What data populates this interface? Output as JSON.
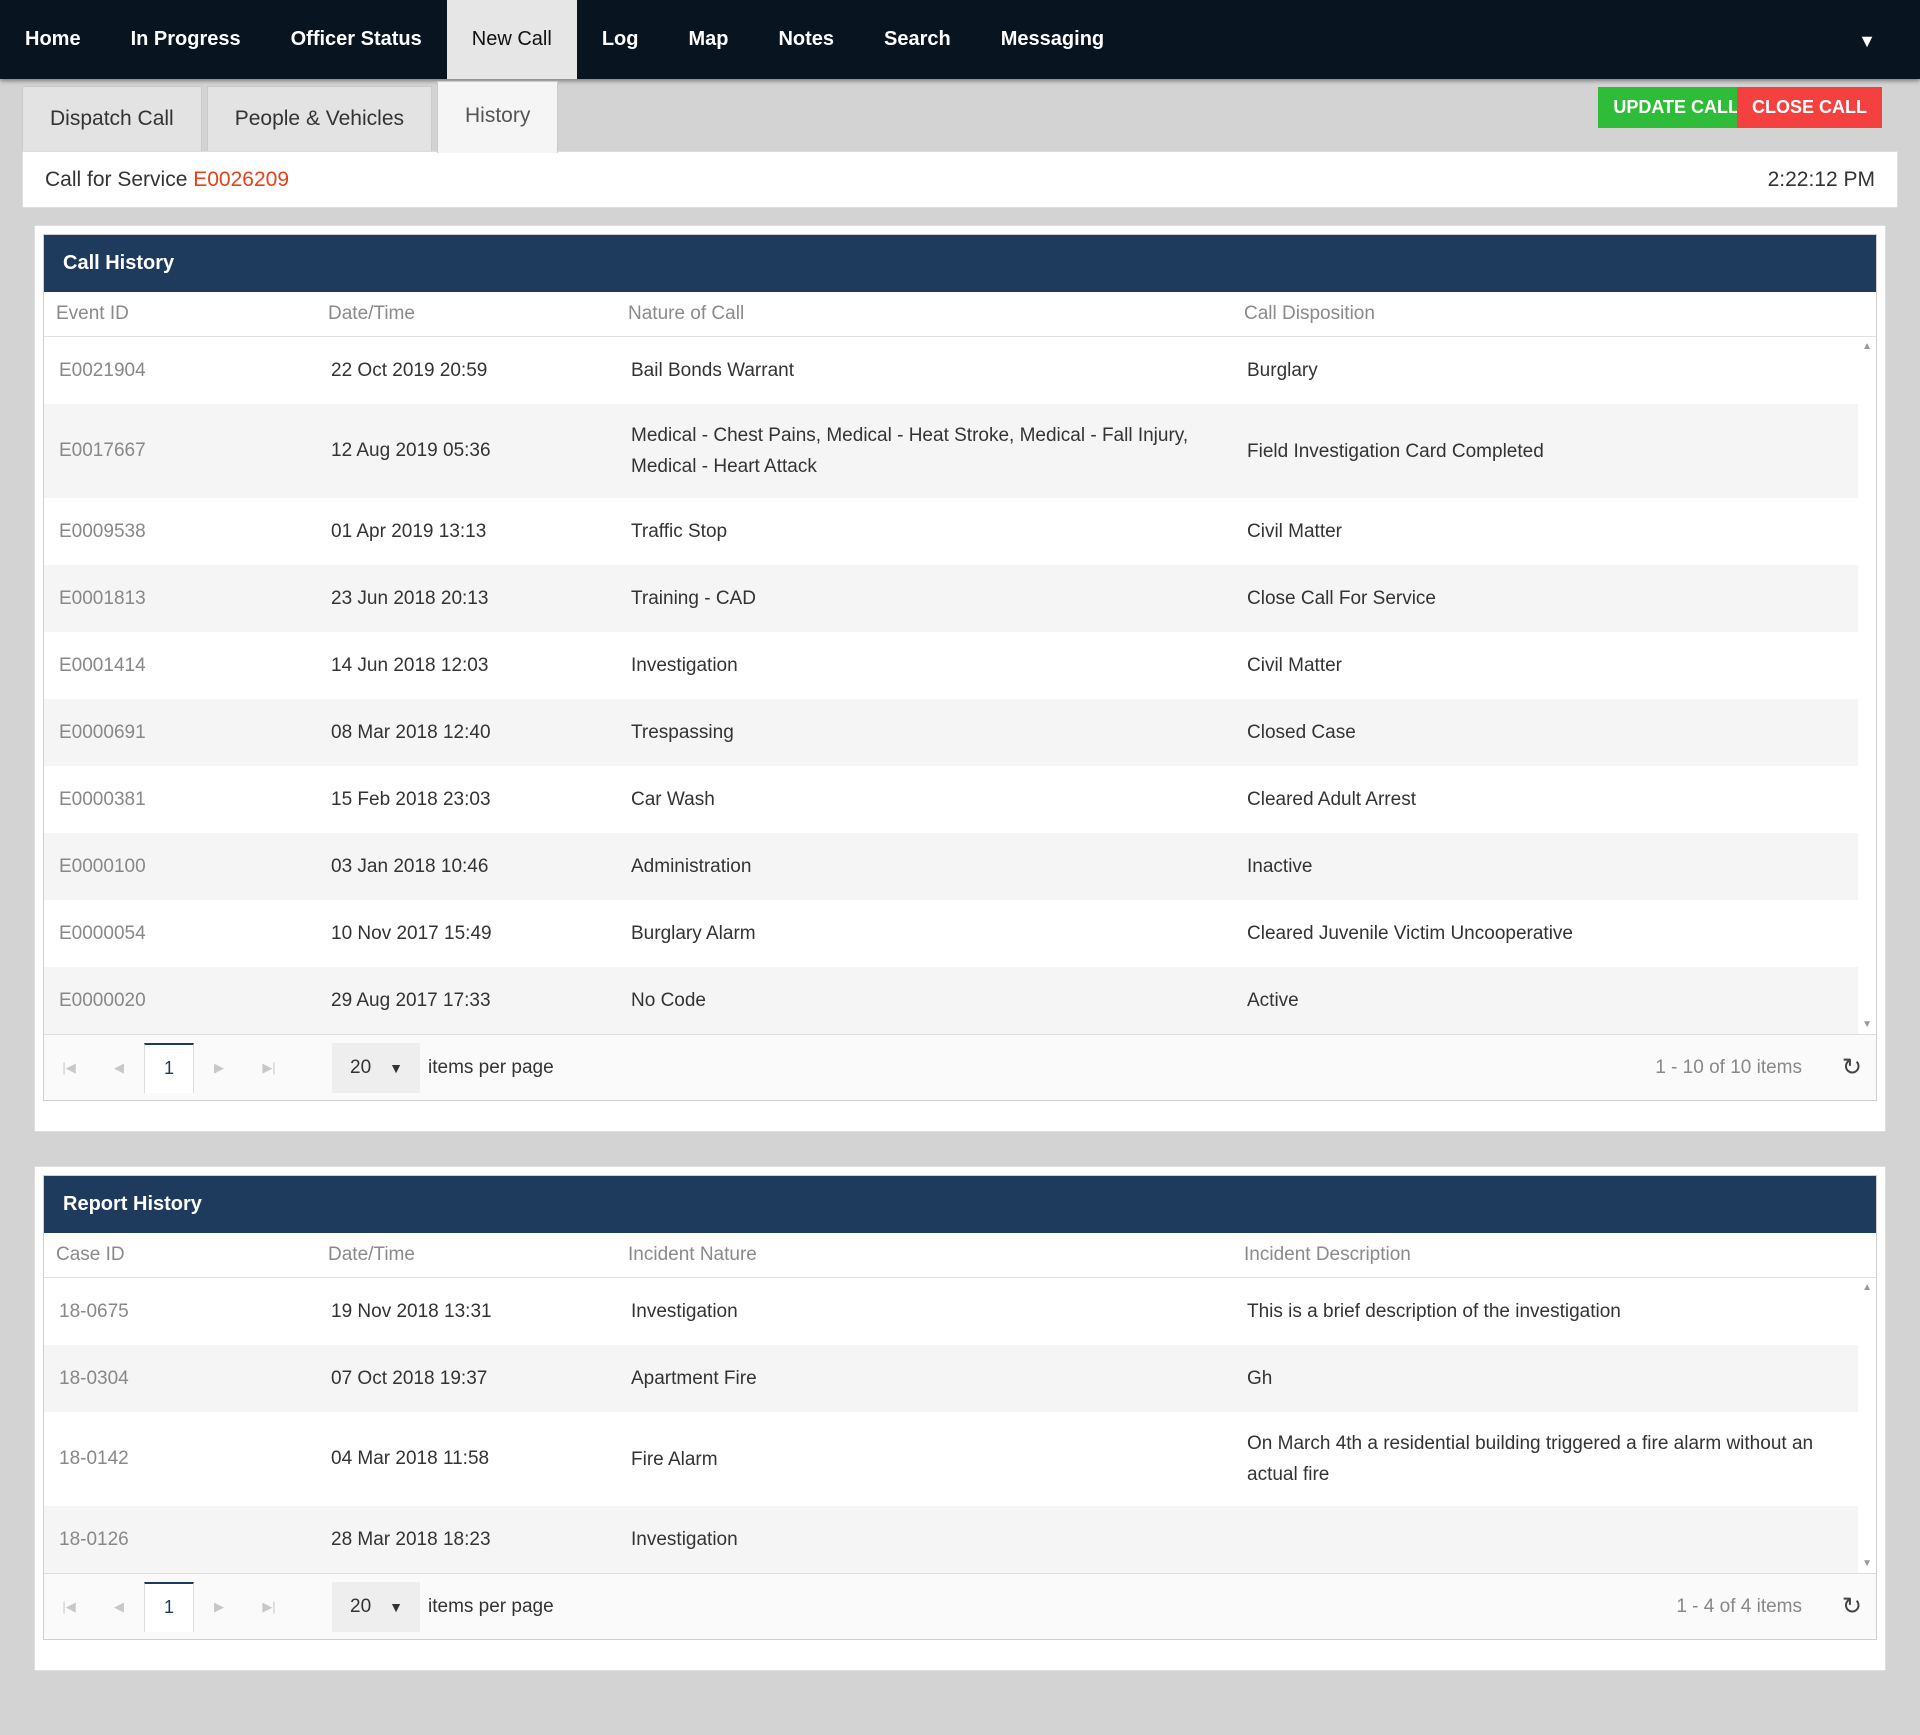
{
  "nav": {
    "items": [
      "Home",
      "In Progress",
      "Officer Status",
      "New Call",
      "Log",
      "Map",
      "Notes",
      "Search",
      "Messaging"
    ],
    "active": "New Call",
    "dropdown_icon": "caret-down-icon"
  },
  "subtabs": {
    "dispatch": "Dispatch Call",
    "people": "People & Vehicles",
    "history": "History"
  },
  "actions": {
    "update": "UPDATE CALL",
    "close": "CLOSE CALL",
    "update_color": "#2fbc38",
    "close_color": "#f54040"
  },
  "call": {
    "label": "Call for Service",
    "id": "E0026209",
    "time": "2:22:12 PM"
  },
  "call_history": {
    "title": "Call History",
    "columns": [
      "Event ID",
      "Date/Time",
      "Nature of Call",
      "Call Disposition"
    ],
    "rows": [
      [
        "E0021904",
        "22 Oct 2019 20:59",
        "Bail Bonds Warrant",
        "Burglary"
      ],
      [
        "E0017667",
        "12 Aug 2019 05:36",
        "Medical - Chest Pains, Medical - Heat Stroke, Medical - Fall Injury, Medical - Heart Attack",
        "Field Investigation Card Completed"
      ],
      [
        "E0009538",
        "01 Apr 2019 13:13",
        "Traffic Stop",
        "Civil Matter"
      ],
      [
        "E0001813",
        "23 Jun 2018 20:13",
        "Training - CAD",
        "Close Call For Service"
      ],
      [
        "E0001414",
        "14 Jun 2018 12:03",
        "Investigation",
        "Civil Matter"
      ],
      [
        "E0000691",
        "08 Mar 2018 12:40",
        "Trespassing",
        "Closed Case"
      ],
      [
        "E0000381",
        "15 Feb 2018 23:03",
        "Car Wash",
        "Cleared Adult Arrest"
      ],
      [
        "E0000100",
        "03 Jan 2018 10:46",
        "Administration",
        "Inactive"
      ],
      [
        "E0000054",
        "10 Nov 2017 15:49",
        "Burglary Alarm",
        "Cleared Juvenile Victim Uncooperative"
      ],
      [
        "E0000020",
        "29 Aug 2017 17:33",
        "No Code",
        "Active"
      ]
    ],
    "pager": {
      "page": "1",
      "page_size": "20",
      "items_label": "items per page",
      "info": "1 - 10 of 10 items"
    }
  },
  "report_history": {
    "title": "Report History",
    "columns": [
      "Case ID",
      "Date/Time",
      "Incident Nature",
      "Incident Description"
    ],
    "rows": [
      [
        "18-0675",
        "19 Nov 2018 13:31",
        "Investigation",
        "This is a brief description of the investigation"
      ],
      [
        "18-0304",
        "07 Oct 2018 19:37",
        "Apartment Fire",
        "Gh"
      ],
      [
        "18-0142",
        "04 Mar 2018 11:58",
        "Fire Alarm",
        "On March 4th a residential building triggered a fire alarm without an actual fire"
      ],
      [
        "18-0126",
        "28 Mar 2018 18:23",
        "Investigation",
        ""
      ]
    ],
    "pager": {
      "page": "1",
      "page_size": "20",
      "items_label": "items per page",
      "info": "1 - 4 of 4 items"
    }
  }
}
